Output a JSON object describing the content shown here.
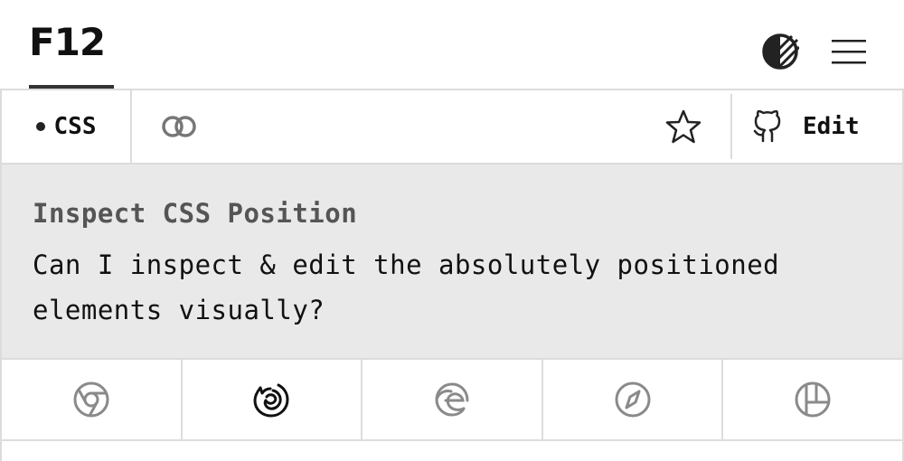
{
  "header": {
    "logo": "F12",
    "theme_icon": "contrast-icon",
    "menu_icon": "hamburger-menu-icon"
  },
  "toolbar": {
    "tag_label": "CSS",
    "link_icon": "link-icon",
    "star_icon": "star-icon",
    "github_icon": "github-icon",
    "edit_label": "Edit"
  },
  "question": {
    "title": "Inspect CSS Position",
    "text": "Can I inspect & edit the absolutely positioned elements visually?"
  },
  "browsers": [
    {
      "icon": "chrome-icon",
      "selected": false
    },
    {
      "icon": "firefox-icon",
      "selected": true
    },
    {
      "icon": "edge-icon",
      "selected": false
    },
    {
      "icon": "safari-icon",
      "selected": false
    },
    {
      "icon": "polypane-icon",
      "selected": false
    }
  ],
  "colors": {
    "panel_bg": "#e9e9e9",
    "border": "#dcdcdc",
    "inactive_icon": "#8a8a8a",
    "active_icon": "#111111"
  }
}
